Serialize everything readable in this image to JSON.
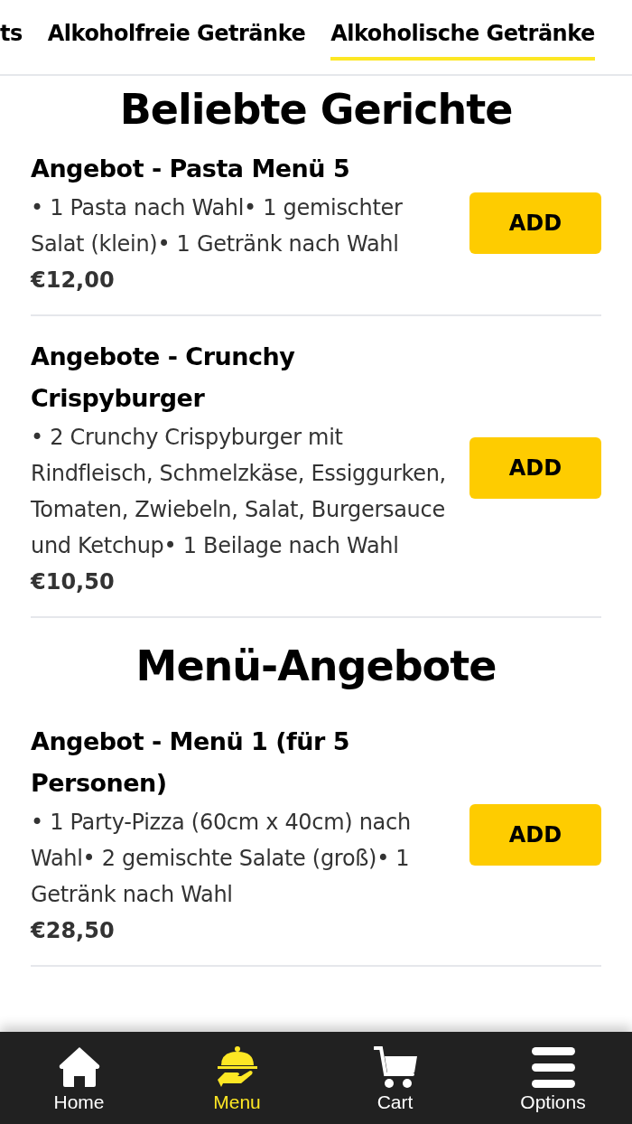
{
  "category_tabs": [
    {
      "label": "ts",
      "selected": false
    },
    {
      "label": "Alkoholfreie Getränke",
      "selected": false
    },
    {
      "label": "Alkoholische Getränke",
      "selected": true
    }
  ],
  "sections": [
    {
      "title": "Beliebte Gerichte",
      "items": [
        {
          "name": "Angebot - Pasta Menü 5",
          "description": "• 1 Pasta nach Wahl• 1 gemischter Salat (klein)• 1 Getränk nach Wahl",
          "price": "€12,00",
          "button": "ADD"
        },
        {
          "name": "Angebote - Crunchy Crispyburger",
          "description": "• 2 Crunchy Crispyburger mit Rindfleisch, Schmelzkäse, Essiggurken, Tomaten, Zwiebeln, Salat, Burgersauce und Ketchup• 1 Beilage nach Wahl",
          "price": "€10,50",
          "button": "ADD"
        }
      ]
    },
    {
      "title": "Menü-Angebote",
      "items": [
        {
          "name": "Angebot - Menü 1 (für 5 Personen)",
          "description": "• 1 Party-Pizza (60cm x 40cm) nach Wahl• 2 gemischte Salate (groß)• 1 Getränk nach Wahl",
          "price": "€28,50",
          "button": "ADD"
        }
      ]
    }
  ],
  "bottom_nav": [
    {
      "kind": "home",
      "label": "Home",
      "selected": false
    },
    {
      "kind": "menu",
      "label": "Menu",
      "selected": true
    },
    {
      "kind": "cart",
      "label": "Cart",
      "selected": false
    },
    {
      "kind": "options",
      "label": "Options",
      "selected": false
    }
  ]
}
